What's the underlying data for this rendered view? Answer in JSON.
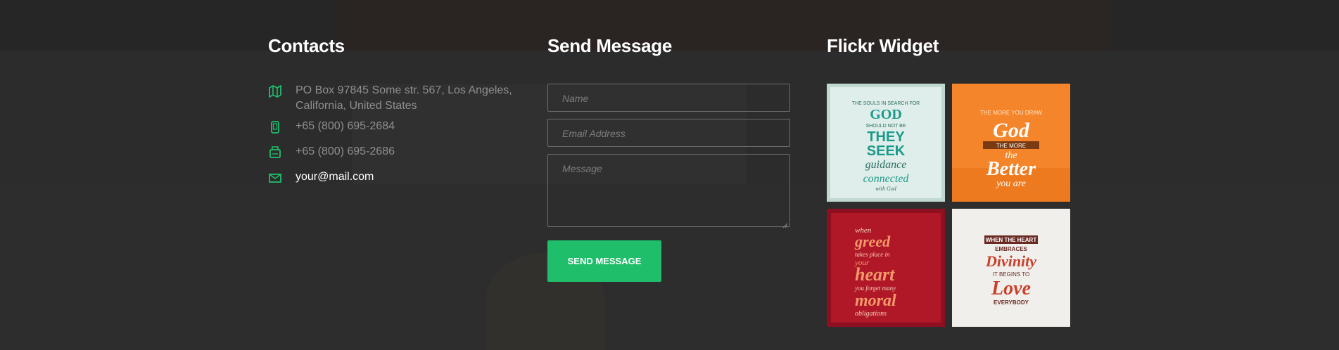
{
  "contacts": {
    "title": "Contacts",
    "address": "PO Box 97845 Some str. 567, Los Angeles, California, United States",
    "phone": "+65 (800) 695-2684",
    "fax": "+65 (800) 695-2686",
    "email": "your@mail.com",
    "icons": [
      "map-icon",
      "phone-icon",
      "fax-icon",
      "mail-icon"
    ],
    "accent_color": "#1fbe6b"
  },
  "send_message": {
    "title": "Send Message",
    "name_placeholder": "Name",
    "email_placeholder": "Email Address",
    "message_placeholder": "Message",
    "button_label": "SEND MESSAGE",
    "button_color": "#1fbe6b"
  },
  "flickr": {
    "title": "Flickr Widget",
    "images": [
      {
        "name": "quote-god-they-seek",
        "lines": [
          "THE SOULS IN SEARCH FOR",
          "GOD",
          "SHOULD NOT BE",
          "THEY",
          "SEEK",
          "guidance",
          "connected",
          "with God"
        ],
        "background": "#dfeeea",
        "ink": "#1a9a8a"
      },
      {
        "name": "quote-god-better",
        "lines": [
          "THE MORE YOU DRAW",
          "God",
          "THE MORE",
          "the",
          "Better",
          "you are"
        ],
        "background": "#f5852a",
        "ink": "#ffffff"
      },
      {
        "name": "quote-greed-heart",
        "lines": [
          "when",
          "greed",
          "takes place in",
          "your",
          "heart",
          "you forget many",
          "moral",
          "obligations"
        ],
        "background": "#b01828",
        "ink": "#f39a6b"
      },
      {
        "name": "quote-heart-divinity",
        "lines": [
          "WHEN THE HEART",
          "EMBRACES",
          "Divinity",
          "IT BEGINS TO",
          "Love",
          "EVERYBODY"
        ],
        "background": "#f1efec",
        "ink": "#c9402b"
      }
    ]
  }
}
